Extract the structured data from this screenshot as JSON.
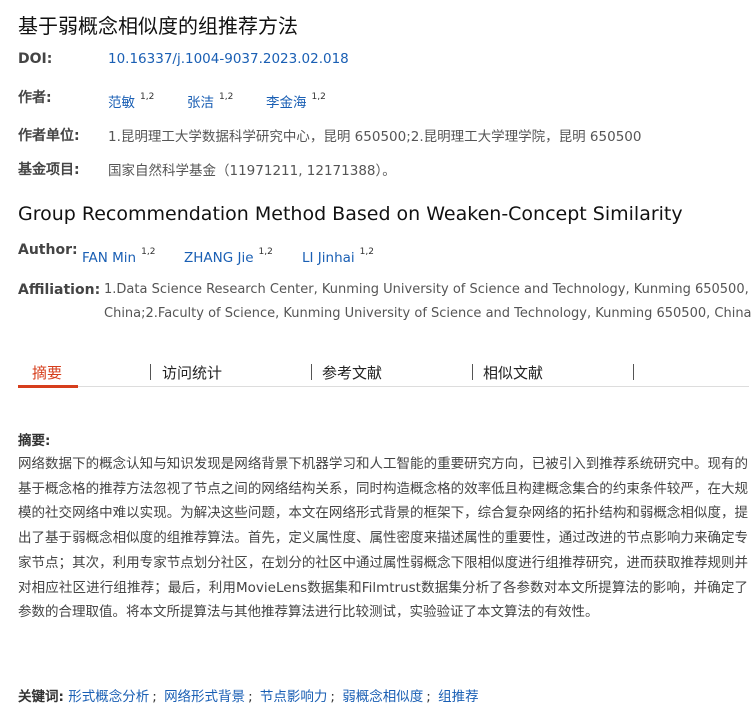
{
  "title_cn": "基于弱概念相似度的组推荐方法",
  "doi": {
    "label": "DOI:",
    "value": "10.16337/j.1004-9037.2023.02.018"
  },
  "authors_cn": {
    "label": "作者:",
    "items": [
      {
        "name": "范敏",
        "sup": "1,2"
      },
      {
        "name": "张洁",
        "sup": "1,2"
      },
      {
        "name": "李金海",
        "sup": "1,2"
      }
    ]
  },
  "affiliation_cn": {
    "label": "作者单位:",
    "value": "1.昆明理工大学数据科学研究中心，昆明 650500;2.昆明理工大学理学院，昆明 650500"
  },
  "fund": {
    "label": "基金项目:",
    "value": "国家自然科学基金（11971211, 12171388）。"
  },
  "title_en": "Group Recommendation Method Based on Weaken-Concept Similarity",
  "authors_en": {
    "label": "Author:",
    "items": [
      {
        "name": "FAN Min",
        "sup": "1,2"
      },
      {
        "name": "ZHANG Jie",
        "sup": "1,2"
      },
      {
        "name": "LI Jinhai",
        "sup": "1,2"
      }
    ]
  },
  "affiliation_en": {
    "label": "Affiliation:",
    "line1": "1.Data Science Research Center, Kunming University of Science and Technology, Kunming 650500,",
    "line2": "China;2.Faculty of Science, Kunming University of Science and Technology, Kunming 650500, China"
  },
  "tabs": [
    "摘要",
    "访问统计",
    "参考文献",
    "相似文献"
  ],
  "abstract": {
    "label": "摘要:",
    "text": "网络数据下的概念认知与知识发现是网络背景下机器学习和人工智能的重要研究方向，已被引入到推荐系统研究中。现有的基于概念格的推荐方法忽视了节点之间的网络结构关系，同时构造概念格的效率低且构建概念集合的约束条件较严，在大规模的社交网络中难以实现。为解决这些问题，本文在网络形式背景的框架下，综合复杂网络的拓扑结构和弱概念相似度，提出了基于弱概念相似度的组推荐算法。首先，定义属性度、属性密度来描述属性的重要性，通过改进的节点影响力来确定专家节点；其次，利用专家节点划分社区，在划分的社区中通过属性弱概念下限相似度进行组推荐研究，进而获取推荐规则并对相应社区进行组推荐；最后，利用MovieLens数据集和Filmtrust数据集分析了各参数对本文所提算法的影响，并确定了参数的合理取值。将本文所提算法与其他推荐算法进行比较测试，实验验证了本文算法的有效性。"
  },
  "keywords": {
    "label": "关键词:",
    "items": [
      "形式概念分析",
      "网络形式背景",
      "节点影响力",
      "弱概念相似度",
      "组推荐"
    ]
  },
  "colors": {
    "link": "#1a5fb4",
    "accent": "#d63e1c"
  }
}
